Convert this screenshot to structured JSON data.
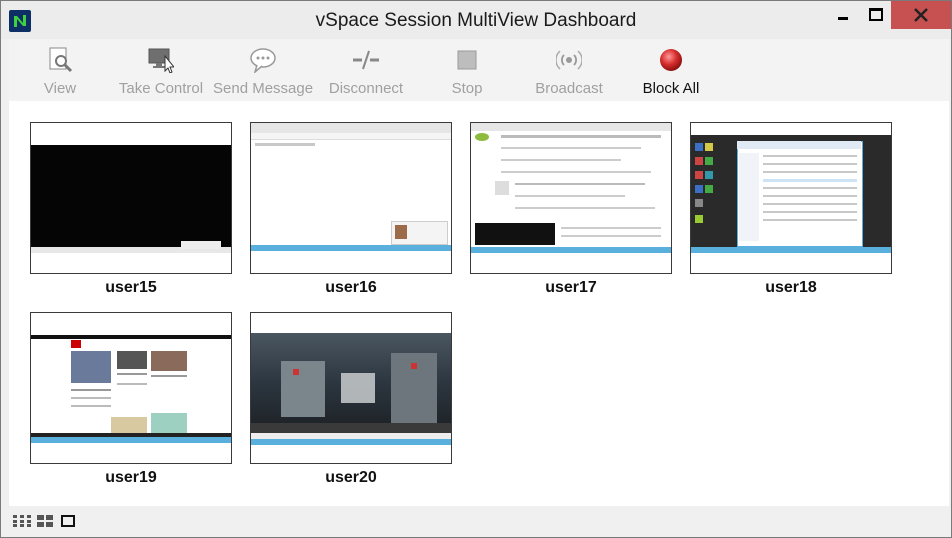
{
  "window": {
    "title": "vSpace Session MultiView Dashboard"
  },
  "toolbar": {
    "view": "View",
    "take_control": "Take Control",
    "send_message": "Send Message",
    "disconnect": "Disconnect",
    "stop": "Stop",
    "broadcast": "Broadcast",
    "block_all": "Block All"
  },
  "sessions": [
    {
      "user": "user15",
      "screen": "dark video playback with desktop taskbar"
    },
    {
      "user": "user16",
      "screen": "web browser with mostly blank page"
    },
    {
      "user": "user17",
      "screen": "web forum page with dialog box"
    },
    {
      "user": "user18",
      "screen": "file explorer on dark desktop"
    },
    {
      "user": "user19",
      "screen": "news website in browser"
    },
    {
      "user": "user20",
      "screen": "video of sci-fi scene in browser"
    }
  ],
  "colors": {
    "close_button": "#c75050",
    "block_all_icon": "#d62c2c",
    "app_icon": "#0e2f66",
    "taskbar": "#2b8cc4"
  }
}
